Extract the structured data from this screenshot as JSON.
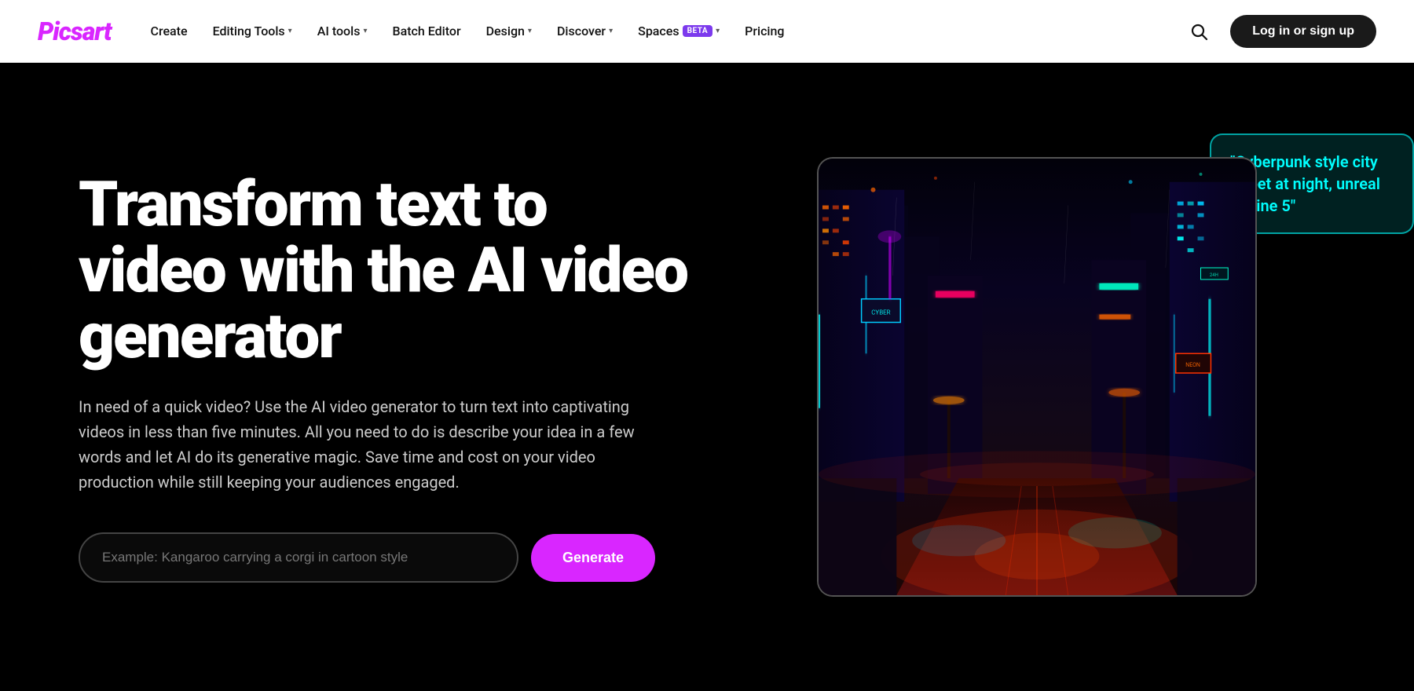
{
  "header": {
    "logo": "Picsart",
    "nav": {
      "items": [
        {
          "id": "create",
          "label": "Create",
          "hasDropdown": false
        },
        {
          "id": "editing-tools",
          "label": "Editing Tools",
          "hasDropdown": true
        },
        {
          "id": "ai-tools",
          "label": "AI tools",
          "hasDropdown": true
        },
        {
          "id": "batch-editor",
          "label": "Batch Editor",
          "hasDropdown": false
        },
        {
          "id": "design",
          "label": "Design",
          "hasDropdown": true
        },
        {
          "id": "discover",
          "label": "Discover",
          "hasDropdown": true
        },
        {
          "id": "spaces",
          "label": "Spaces",
          "badge": "BETA",
          "hasDropdown": true
        },
        {
          "id": "pricing",
          "label": "Pricing",
          "hasDropdown": false
        }
      ]
    },
    "login_button": "Log in or sign up"
  },
  "hero": {
    "title": "Transform text to video with the AI video generator",
    "description": "In need of a quick video? Use the AI video generator to turn text into captivating videos in less than five minutes. All you need to do is describe your idea in a few words and let AI do its generative magic. Save time and cost on your video production while still keeping your audiences engaged.",
    "input_placeholder": "Example: Kangaroo carrying a corgi in cartoon style",
    "generate_button": "Generate",
    "speech_bubble_text": "\"Cyberpunk style city street at night, unreal engine 5\""
  },
  "icons": {
    "search": "🔍",
    "chevron": "▾"
  }
}
